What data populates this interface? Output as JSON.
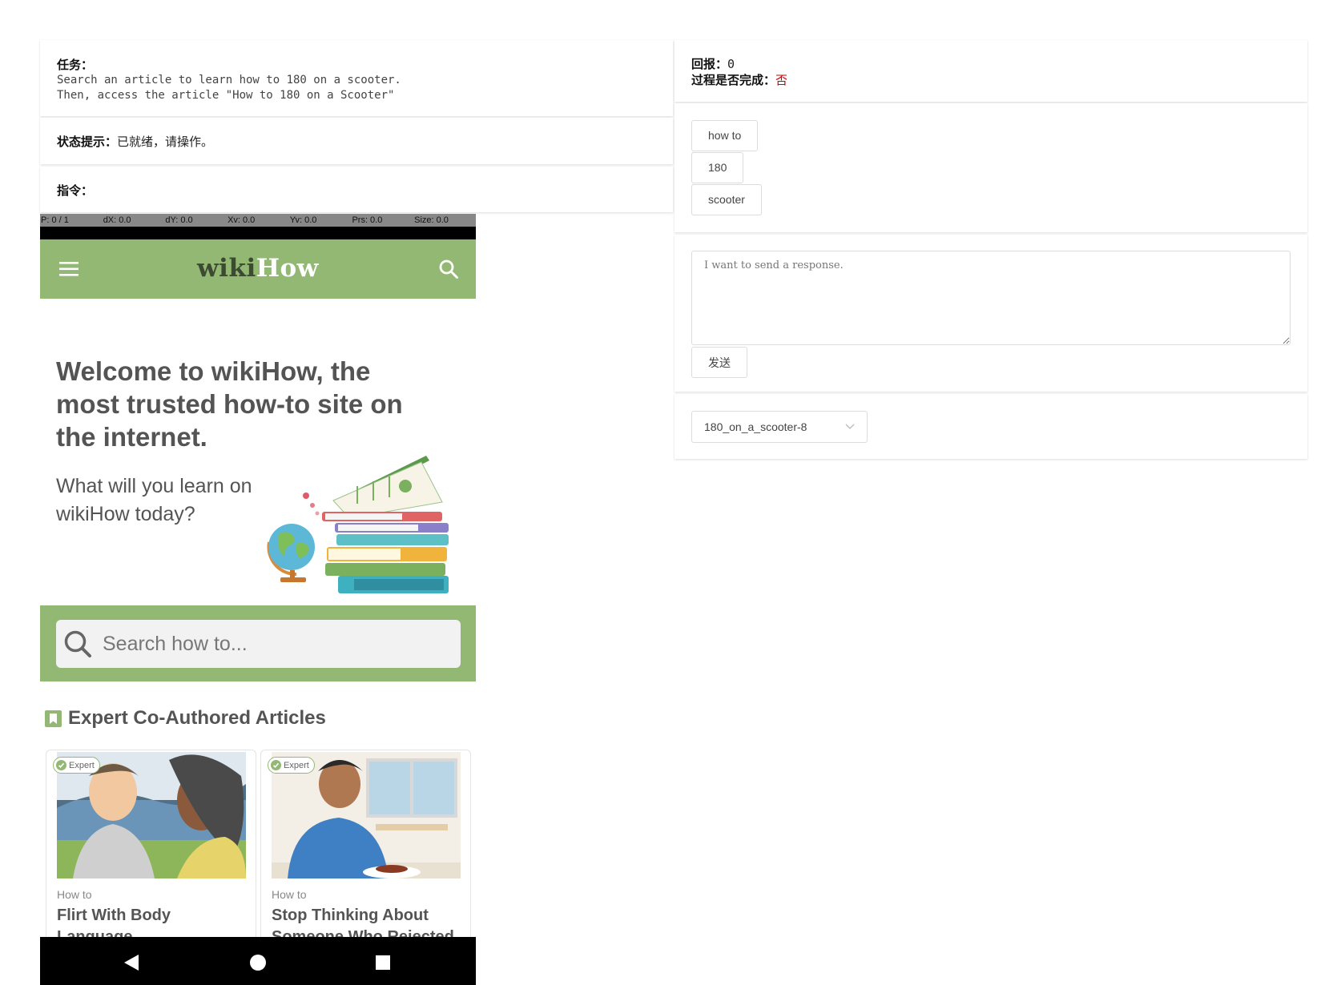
{
  "task": {
    "label": "任务：",
    "lines": [
      "Search an article to learn how to 180 on a scooter.",
      "Then, access the article \"How to 180 on a Scooter\""
    ]
  },
  "status": {
    "label": "状态提示：",
    "value": "已就绪，请操作。"
  },
  "command": {
    "label": "指令："
  },
  "reward": {
    "label": "回报：",
    "value": "0",
    "done_label": "过程是否完成：",
    "done_value": "否",
    "done_color": "#d00000"
  },
  "keywords": [
    "how to",
    "180",
    "scooter"
  ],
  "response": {
    "placeholder": "I want to send a response.",
    "send_label": "发送"
  },
  "episode_select": {
    "value": "180_on_a_scooter-8"
  },
  "phone": {
    "debug": [
      "P: 0 / 1",
      "dX: 0.0",
      "dY: 0.0",
      "Xv: 0.0",
      "Yv: 0.0",
      "Prs: 0.0",
      "Size: 0.0"
    ],
    "logo_part1": "wiki",
    "logo_part2": "How",
    "brand_color": "#93b874",
    "welcome": "Welcome to wikiHow, the most trusted how-to site on the internet.",
    "question": "What will you learn on wikiHow today?",
    "search_placeholder": "Search how to...",
    "expert_heading": "Expert Co-Authored Articles",
    "articles": [
      {
        "badge": "Expert",
        "prefix": "How to",
        "title": "Flirt With Body Language"
      },
      {
        "badge": "Expert",
        "prefix": "How to",
        "title": "Stop Thinking About Someone Who Rejected"
      }
    ]
  }
}
